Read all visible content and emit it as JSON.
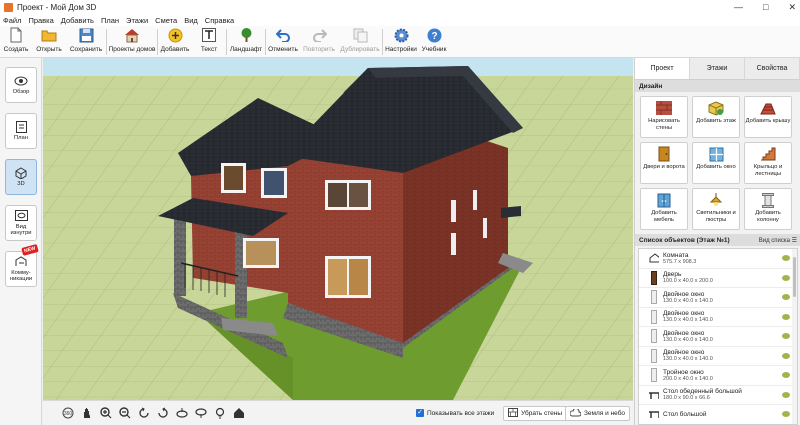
{
  "window": {
    "title": "Проект - Мой Дом 3D",
    "controls": [
      "—",
      "□",
      "✕"
    ]
  },
  "menu": [
    "Файл",
    "Правка",
    "Добавить",
    "План",
    "Этажи",
    "Смета",
    "Вид",
    "Справка"
  ],
  "toolbar": {
    "items": [
      {
        "name": "create-button",
        "label": "Создать",
        "icon": "new-doc-icon",
        "disabled": false
      },
      {
        "name": "open-button",
        "label": "Открыть",
        "icon": "folder-icon",
        "disabled": false
      },
      {
        "name": "save-button",
        "label": "Сохранить",
        "icon": "floppy-icon",
        "disabled": false
      },
      {
        "name": "house-projects-button",
        "label": "Проекты домов",
        "icon": "house-icon",
        "disabled": false
      },
      {
        "name": "add-button",
        "label": "Добавить",
        "icon": "plus-icon",
        "disabled": false
      },
      {
        "name": "text-button",
        "label": "Текст",
        "icon": "text-icon",
        "disabled": false
      },
      {
        "name": "landscape-button",
        "label": "Ландшафт",
        "icon": "tree-icon",
        "disabled": false
      },
      {
        "name": "undo-button",
        "label": "Отменить",
        "icon": "undo-icon",
        "disabled": false
      },
      {
        "name": "redo-button",
        "label": "Повторить",
        "icon": "redo-icon",
        "disabled": true
      },
      {
        "name": "duplicate-button",
        "label": "Дублировать",
        "icon": "duplicate-icon",
        "disabled": true
      },
      {
        "name": "settings-button",
        "label": "Настройки",
        "icon": "gear-icon",
        "disabled": false
      },
      {
        "name": "tutorial-button",
        "label": "Учебник",
        "icon": "help-icon",
        "disabled": false
      }
    ]
  },
  "left_panel": [
    {
      "label": "Обзор",
      "icon": "eye-icon",
      "active": false
    },
    {
      "label": "План",
      "icon": "plan-icon",
      "active": false
    },
    {
      "label": "3D",
      "icon": "cube-icon",
      "active": true
    },
    {
      "label": "Вид изнутри",
      "icon": "inside-view-icon",
      "active": false
    },
    {
      "label": "Комму-никации",
      "icon": "communications-icon",
      "active": false
    }
  ],
  "new_badge": "NEW",
  "bottom_bar": {
    "show_all_floors": "Показывать все этажи",
    "hide_walls": "Убрать стены",
    "ground_sky": "Земля и небо"
  },
  "right_panel": {
    "tabs": [
      "Проект",
      "Этажи",
      "Свойства"
    ],
    "active_tab": 0,
    "design_title": "Дизайн",
    "design_buttons": [
      {
        "label": "Нарисовать стены",
        "icon": "wall-icon"
      },
      {
        "label": "Добавить этаж",
        "icon": "floor-icon"
      },
      {
        "label": "Добавить крышу",
        "icon": "roof-icon"
      },
      {
        "label": "Двери и ворота",
        "icon": "door-icon"
      },
      {
        "label": "Добавить окно",
        "icon": "window-icon"
      },
      {
        "label": "Крыльцо и лестницы",
        "icon": "stairs-icon"
      },
      {
        "label": "Добавить мебель",
        "icon": "furniture-icon"
      },
      {
        "label": "Светильники и люстры",
        "icon": "lamp-icon"
      },
      {
        "label": "Добавить колонну",
        "icon": "column-icon"
      }
    ],
    "objects_title": "Список объектов (Этаж №1)",
    "objects_view_link": "Вид списка",
    "objects": [
      {
        "name": "Комната",
        "dims": "575.7 x 908.3",
        "icon": "room-icon"
      },
      {
        "name": "Дверь",
        "dims": "100.0 x 40.0 x 200.0",
        "icon": "door-icon"
      },
      {
        "name": "Двойное окно",
        "dims": "130.0 x 40.0 x 140.0",
        "icon": "window-icon"
      },
      {
        "name": "Двойное окно",
        "dims": "130.0 x 40.0 x 140.0",
        "icon": "window-icon"
      },
      {
        "name": "Двойное окно",
        "dims": "130.0 x 40.0 x 140.0",
        "icon": "window-icon"
      },
      {
        "name": "Двойное окно",
        "dims": "130.0 x 40.0 x 140.0",
        "icon": "window-icon"
      },
      {
        "name": "Тройное окно",
        "dims": "200.0 x 40.0 x 140.0",
        "icon": "window-icon"
      },
      {
        "name": "Стол обеденный большой",
        "dims": "180.0 x 90.0 x 66.6",
        "icon": "table-icon"
      },
      {
        "name": "Стол большой",
        "dims": "",
        "icon": "table-icon"
      }
    ]
  },
  "colors": {
    "accent": "#1f6fd6",
    "active_bg": "#cfe3f5",
    "eye": "#a4b44a"
  }
}
